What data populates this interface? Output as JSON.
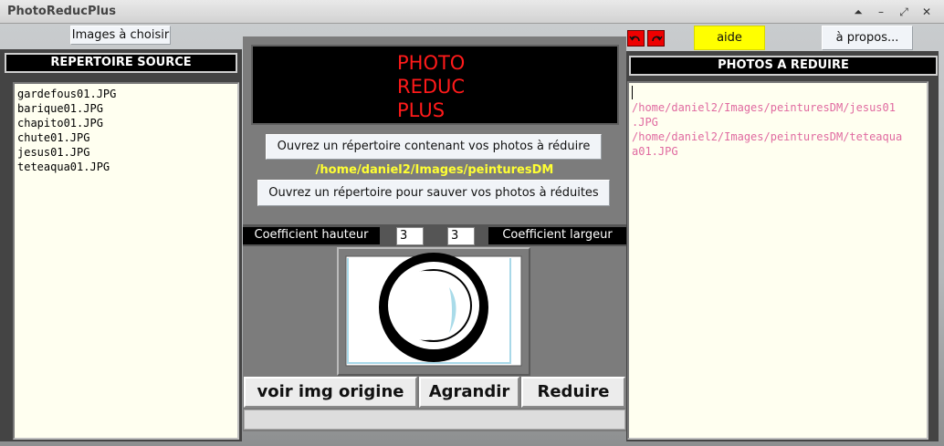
{
  "window": {
    "title": "PhotoReducPlus",
    "controls": [
      "⏶",
      "–",
      "⤢",
      "✕"
    ]
  },
  "toolbar": {
    "images_button": "Images à choisir",
    "aide_button": "aide",
    "apropos_button": "à propos...",
    "aide_color": "#ffff00"
  },
  "left": {
    "header": "REPERTOIRE SOURCE",
    "files": [
      "gardefous01.JPG",
      "barique01.JPG",
      "chapito01.JPG",
      "chute01.JPG",
      "jesus01.JPG",
      "teteaqua01.JPG"
    ]
  },
  "right": {
    "header": "PHOTOS A REDUIRE",
    "paths": [
      "/home/daniel2/Images/peinturesDM/jesus01",
      ".JPG",
      "/home/daniel2/Images/peinturesDM/teteaqua",
      "a01.JPG"
    ]
  },
  "center": {
    "logo_lines": [
      "PHOTO",
      "REDUC",
      "PLUS"
    ],
    "open_source_button": "Ouvrez un répertoire contenant vos photos à réduire",
    "current_dir": "/home/daniel2/Images/peinturesDM",
    "open_dest_button": "Ouvrez un répertoire pour sauver vos photos à réduites",
    "coef_height_label": "Coefficient hauteur",
    "coef_height_value": "3",
    "coef_width_value": "3",
    "coef_width_label": "Coefficient largeur",
    "btn_origin": "voir img origine",
    "btn_enlarge": "Agrandir",
    "btn_reduce": "Reduire",
    "accent_yellow": "#ffff33",
    "logo_red": "#ff1a1a"
  }
}
